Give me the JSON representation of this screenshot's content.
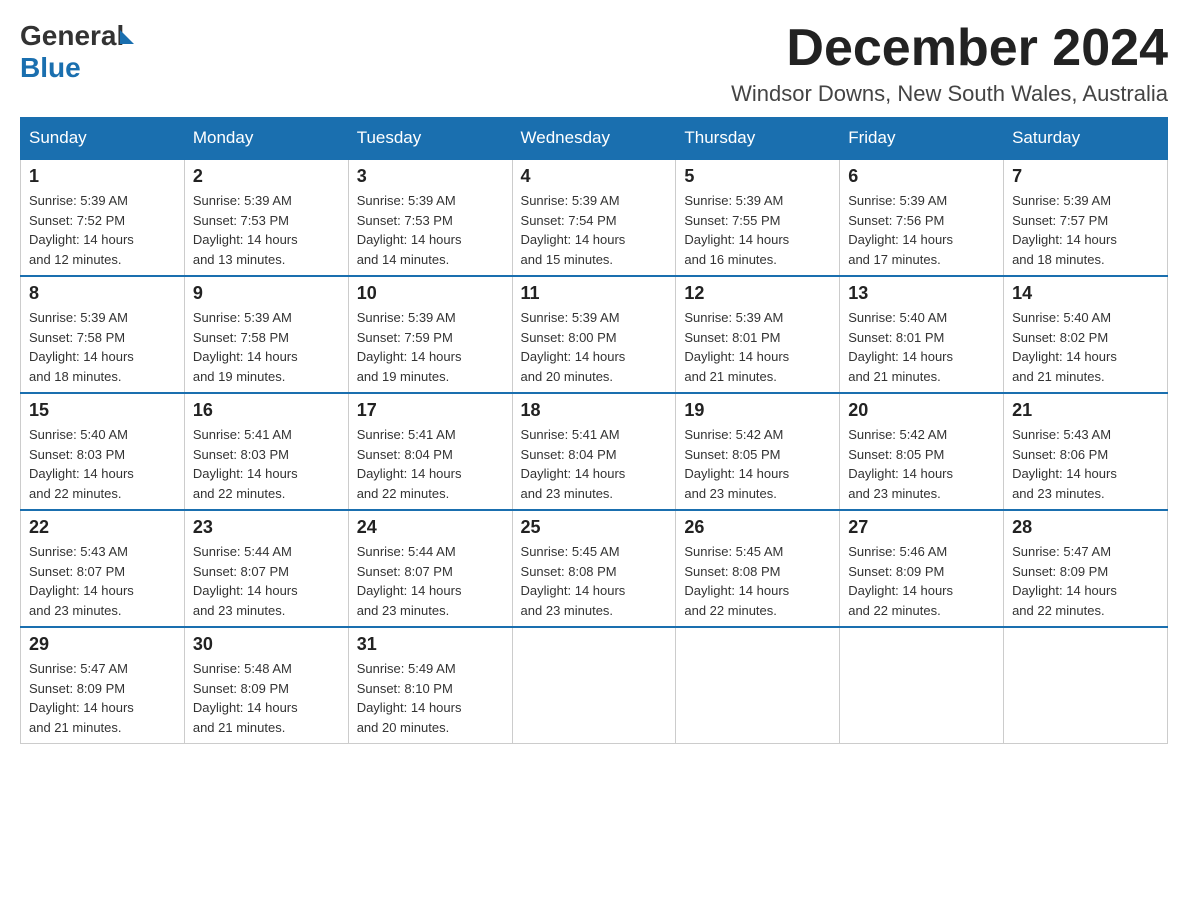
{
  "logo": {
    "text_general": "General",
    "text_blue": "Blue",
    "arrow": "▶"
  },
  "title": {
    "month": "December 2024",
    "location": "Windsor Downs, New South Wales, Australia"
  },
  "headers": [
    "Sunday",
    "Monday",
    "Tuesday",
    "Wednesday",
    "Thursday",
    "Friday",
    "Saturday"
  ],
  "weeks": [
    [
      {
        "day": "1",
        "sunrise": "5:39 AM",
        "sunset": "7:52 PM",
        "daylight": "14 hours and 12 minutes."
      },
      {
        "day": "2",
        "sunrise": "5:39 AM",
        "sunset": "7:53 PM",
        "daylight": "14 hours and 13 minutes."
      },
      {
        "day": "3",
        "sunrise": "5:39 AM",
        "sunset": "7:53 PM",
        "daylight": "14 hours and 14 minutes."
      },
      {
        "day": "4",
        "sunrise": "5:39 AM",
        "sunset": "7:54 PM",
        "daylight": "14 hours and 15 minutes."
      },
      {
        "day": "5",
        "sunrise": "5:39 AM",
        "sunset": "7:55 PM",
        "daylight": "14 hours and 16 minutes."
      },
      {
        "day": "6",
        "sunrise": "5:39 AM",
        "sunset": "7:56 PM",
        "daylight": "14 hours and 17 minutes."
      },
      {
        "day": "7",
        "sunrise": "5:39 AM",
        "sunset": "7:57 PM",
        "daylight": "14 hours and 18 minutes."
      }
    ],
    [
      {
        "day": "8",
        "sunrise": "5:39 AM",
        "sunset": "7:58 PM",
        "daylight": "14 hours and 18 minutes."
      },
      {
        "day": "9",
        "sunrise": "5:39 AM",
        "sunset": "7:58 PM",
        "daylight": "14 hours and 19 minutes."
      },
      {
        "day": "10",
        "sunrise": "5:39 AM",
        "sunset": "7:59 PM",
        "daylight": "14 hours and 19 minutes."
      },
      {
        "day": "11",
        "sunrise": "5:39 AM",
        "sunset": "8:00 PM",
        "daylight": "14 hours and 20 minutes."
      },
      {
        "day": "12",
        "sunrise": "5:39 AM",
        "sunset": "8:01 PM",
        "daylight": "14 hours and 21 minutes."
      },
      {
        "day": "13",
        "sunrise": "5:40 AM",
        "sunset": "8:01 PM",
        "daylight": "14 hours and 21 minutes."
      },
      {
        "day": "14",
        "sunrise": "5:40 AM",
        "sunset": "8:02 PM",
        "daylight": "14 hours and 21 minutes."
      }
    ],
    [
      {
        "day": "15",
        "sunrise": "5:40 AM",
        "sunset": "8:03 PM",
        "daylight": "14 hours and 22 minutes."
      },
      {
        "day": "16",
        "sunrise": "5:41 AM",
        "sunset": "8:03 PM",
        "daylight": "14 hours and 22 minutes."
      },
      {
        "day": "17",
        "sunrise": "5:41 AM",
        "sunset": "8:04 PM",
        "daylight": "14 hours and 22 minutes."
      },
      {
        "day": "18",
        "sunrise": "5:41 AM",
        "sunset": "8:04 PM",
        "daylight": "14 hours and 23 minutes."
      },
      {
        "day": "19",
        "sunrise": "5:42 AM",
        "sunset": "8:05 PM",
        "daylight": "14 hours and 23 minutes."
      },
      {
        "day": "20",
        "sunrise": "5:42 AM",
        "sunset": "8:05 PM",
        "daylight": "14 hours and 23 minutes."
      },
      {
        "day": "21",
        "sunrise": "5:43 AM",
        "sunset": "8:06 PM",
        "daylight": "14 hours and 23 minutes."
      }
    ],
    [
      {
        "day": "22",
        "sunrise": "5:43 AM",
        "sunset": "8:07 PM",
        "daylight": "14 hours and 23 minutes."
      },
      {
        "day": "23",
        "sunrise": "5:44 AM",
        "sunset": "8:07 PM",
        "daylight": "14 hours and 23 minutes."
      },
      {
        "day": "24",
        "sunrise": "5:44 AM",
        "sunset": "8:07 PM",
        "daylight": "14 hours and 23 minutes."
      },
      {
        "day": "25",
        "sunrise": "5:45 AM",
        "sunset": "8:08 PM",
        "daylight": "14 hours and 23 minutes."
      },
      {
        "day": "26",
        "sunrise": "5:45 AM",
        "sunset": "8:08 PM",
        "daylight": "14 hours and 22 minutes."
      },
      {
        "day": "27",
        "sunrise": "5:46 AM",
        "sunset": "8:09 PM",
        "daylight": "14 hours and 22 minutes."
      },
      {
        "day": "28",
        "sunrise": "5:47 AM",
        "sunset": "8:09 PM",
        "daylight": "14 hours and 22 minutes."
      }
    ],
    [
      {
        "day": "29",
        "sunrise": "5:47 AM",
        "sunset": "8:09 PM",
        "daylight": "14 hours and 21 minutes."
      },
      {
        "day": "30",
        "sunrise": "5:48 AM",
        "sunset": "8:09 PM",
        "daylight": "14 hours and 21 minutes."
      },
      {
        "day": "31",
        "sunrise": "5:49 AM",
        "sunset": "8:10 PM",
        "daylight": "14 hours and 20 minutes."
      },
      null,
      null,
      null,
      null
    ]
  ],
  "labels": {
    "sunrise": "Sunrise:",
    "sunset": "Sunset:",
    "daylight": "Daylight:"
  }
}
